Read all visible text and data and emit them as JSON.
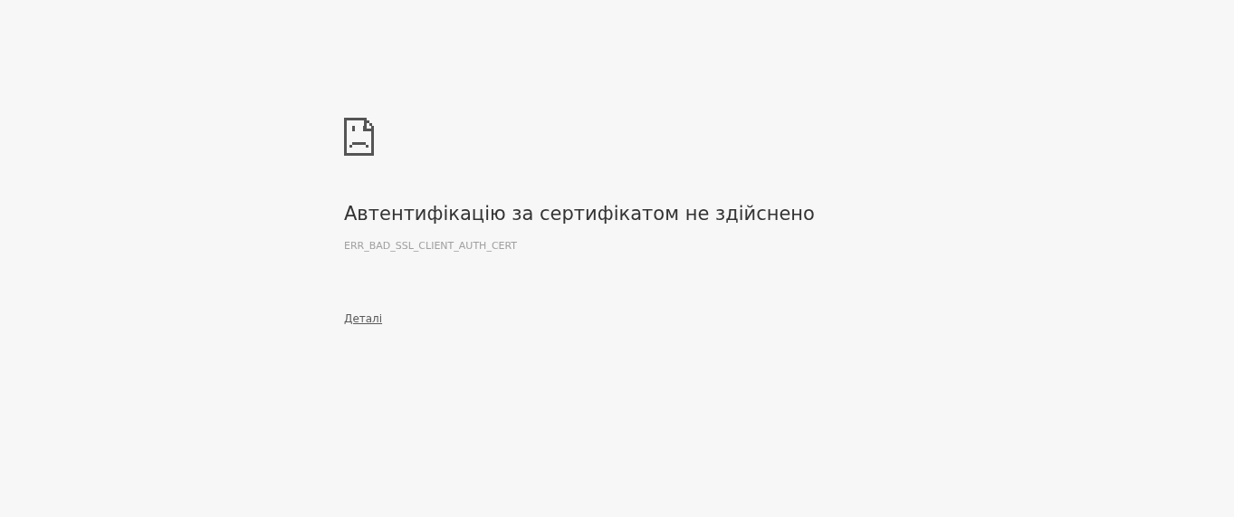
{
  "error": {
    "heading": "Автентифікацію за сертифікатом не здійснено",
    "code": "ERR_BAD_SSL_CLIENT_AUTH_CERT",
    "details_link": "Деталі"
  }
}
